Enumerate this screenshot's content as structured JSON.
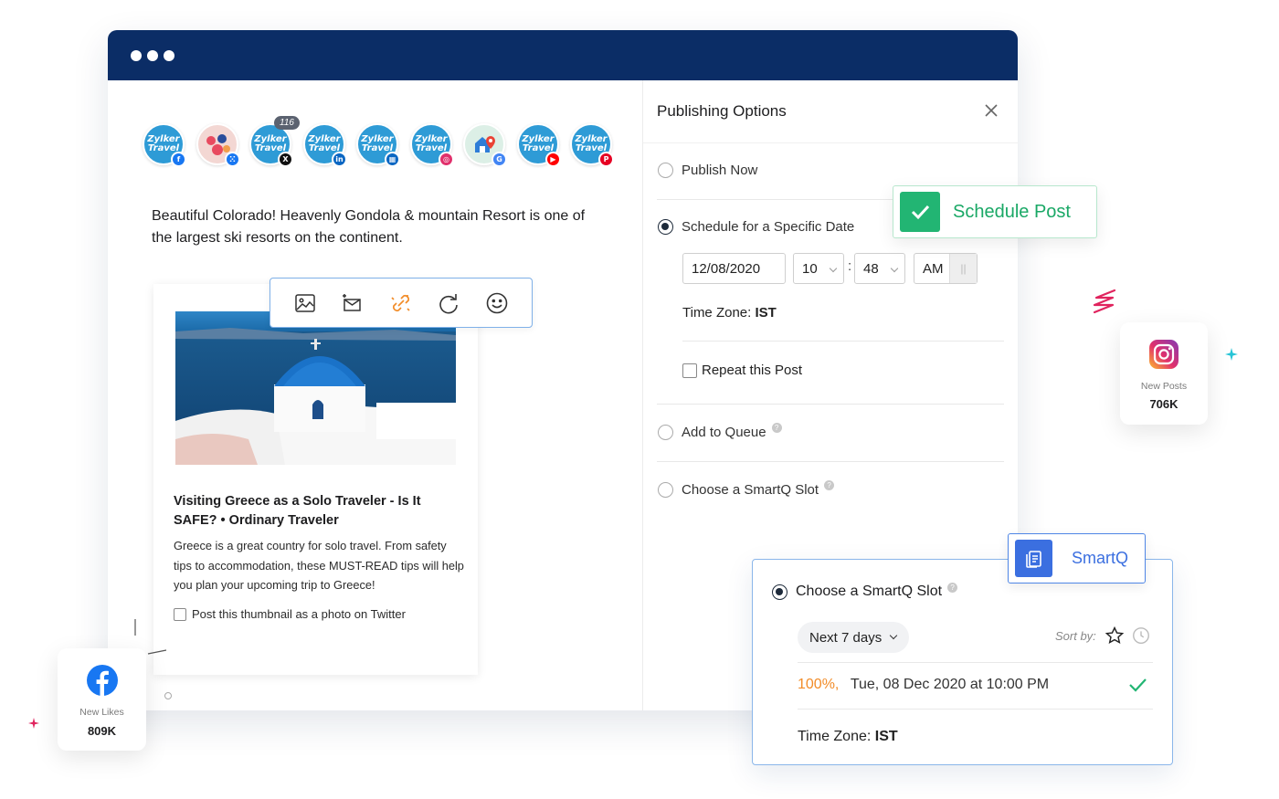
{
  "avatars": {
    "brand_line1": "Zylker",
    "brand_line2": "Travel",
    "count": "116",
    "items": [
      {
        "network": "facebook",
        "badge": "f",
        "color": "#1877f2"
      },
      {
        "network": "facebook-group",
        "badge": "ⵘ",
        "color": "#1877f2"
      },
      {
        "network": "x",
        "badge": "X",
        "color": "#111111"
      },
      {
        "network": "linkedin",
        "badge": "in",
        "color": "#0a66c2"
      },
      {
        "network": "linkedin-page",
        "badge": "▦",
        "color": "#0a66c2"
      },
      {
        "network": "instagram",
        "badge": "◎",
        "color": "#e1306c"
      },
      {
        "network": "google-business",
        "badge": "G",
        "color": "#4285f4"
      },
      {
        "network": "youtube",
        "badge": "▶",
        "color": "#ff0000"
      },
      {
        "network": "pinterest",
        "badge": "P",
        "color": "#e60023"
      }
    ]
  },
  "post": {
    "text": "Beautiful Colorado! Heavenly Gondola & mountain Resort is one of the largest ski resorts on the continent."
  },
  "link_preview": {
    "title": "Visiting Greece as a Solo Traveler - Is It SAFE? • Ordinary Traveler",
    "description": "Greece is a great country for solo travel. From safety tips to accommodation, these MUST-READ tips will help you plan your upcoming trip to Greece!",
    "checkbox_label": "Post this thumbnail as a photo on Twitter"
  },
  "toolbar": {
    "icons": [
      "image-icon",
      "mail-add-icon",
      "link-shorten-icon",
      "redo-icon",
      "emoji-icon"
    ]
  },
  "publishing": {
    "title": "Publishing Options",
    "publish_now": "Publish Now",
    "schedule": "Schedule for a Specific Date",
    "date": "12/08/2020",
    "hour": "10",
    "minute": "48",
    "ampm": "AM",
    "tz_label": "Time Zone:",
    "tz_value": "IST",
    "repeat": "Repeat this Post",
    "add_queue": "Add to Queue",
    "smartq_slot": "Choose a SmartQ Slot"
  },
  "schedule_badge": {
    "label": "Schedule Post"
  },
  "smartq": {
    "badge": "SmartQ",
    "title": "Choose a SmartQ Slot",
    "range": "Next 7 days",
    "sort_label": "Sort by:",
    "percent": "100%",
    "slot": "Tue, 08 Dec 2020 at 10:00 PM",
    "tz_label": "Time Zone:",
    "tz_value": "IST"
  },
  "instagram_card": {
    "label": "New Posts",
    "value": "706K"
  },
  "facebook_card": {
    "label": "New Likes",
    "value": "809K"
  },
  "colors": {
    "titlebar": "#0b2d66",
    "accent_green": "#22b573",
    "accent_blue": "#3b6fe0",
    "percent_orange": "#f28c28"
  }
}
